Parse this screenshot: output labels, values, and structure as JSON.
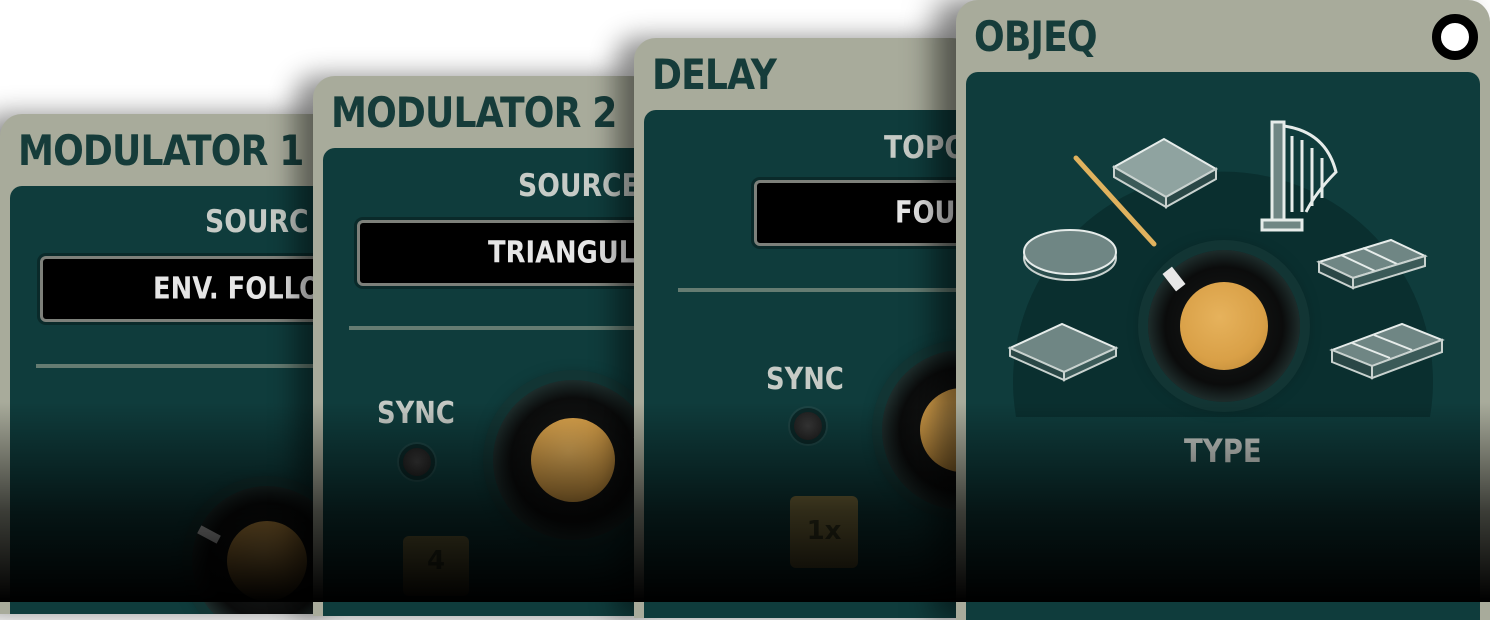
{
  "panels": {
    "modulator1": {
      "title": "MODULATOR 1",
      "source_label": "SOURC",
      "display_value": "ENV. FOLLO"
    },
    "modulator2": {
      "title": "MODULATOR 2",
      "source_label": "SOURCE",
      "display_value": "TRIANGUL",
      "sync_label": "SYNC",
      "chip_value": "4"
    },
    "delay": {
      "title": "DELAY",
      "topo_label": "TOPO",
      "display_value": "FOU",
      "sync_label": "SYNC",
      "chip_value": "1x"
    },
    "objeq": {
      "title": "OBJEQ",
      "knob_label": "TYPE"
    }
  },
  "objeq_icons": [
    "membrane-icon",
    "plate-icon",
    "harp-icon",
    "bars-icon",
    "square-plate-icon",
    "beam-icon"
  ],
  "colors": {
    "panel_bg": "#a8ab9b",
    "inner_bg": "#0f3c3c",
    "knob_cap": "#d9a047",
    "title_text": "#163c3a",
    "indicator_line": "#e0b25e"
  }
}
